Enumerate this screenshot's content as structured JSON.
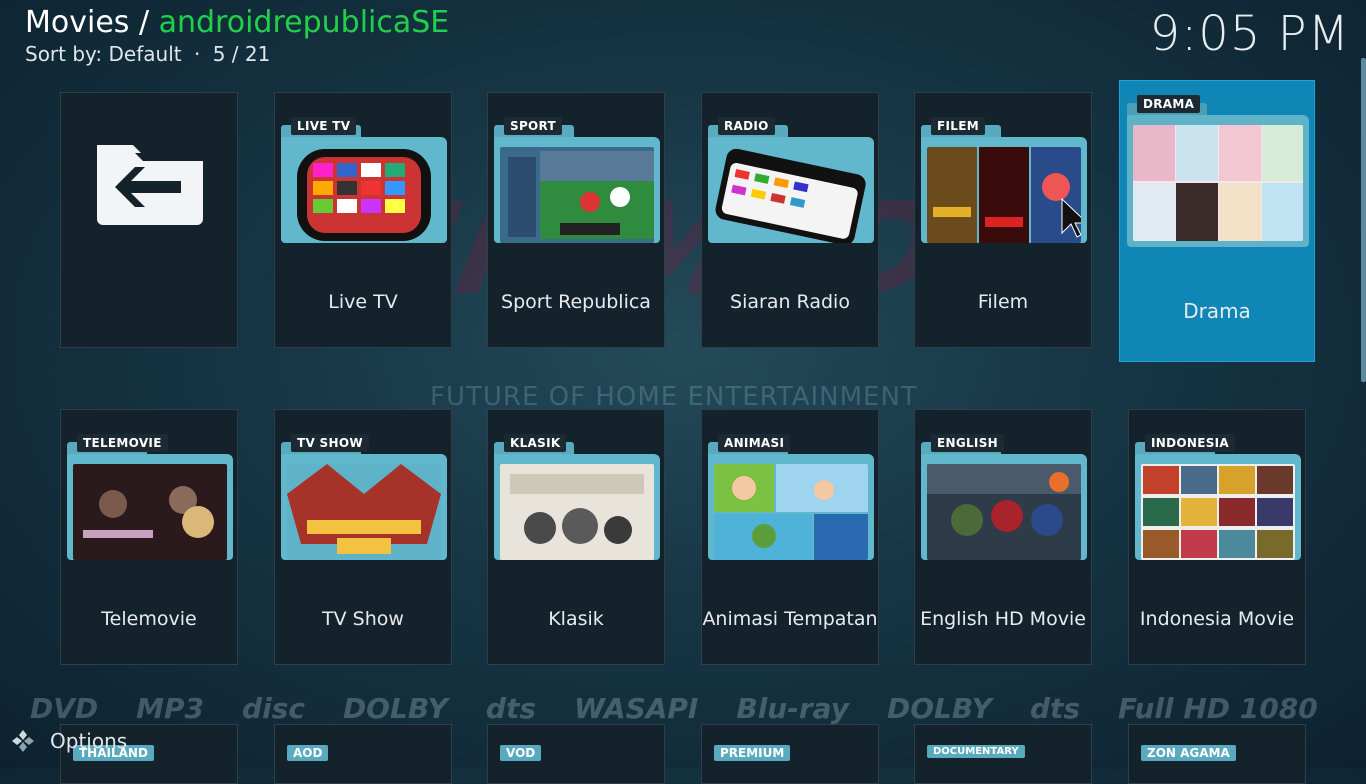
{
  "header": {
    "section": "Movies",
    "separator": " / ",
    "source": "androidrepublicaSE",
    "sort_label": "Sort by: Default",
    "dot": "·",
    "position": "5 / 21",
    "clock": "9:05 PM"
  },
  "background": {
    "wordmark": "KIR MEDIA CENTER",
    "tagline": "FUTURE OF HOME ENTERTAINMENT",
    "logos": [
      "DVD",
      "MP3",
      "disc",
      "DOLBY",
      "dts",
      "WASAPI",
      "Blu-ray",
      "DOLBY",
      "dts",
      "Full HD 1080"
    ]
  },
  "tiles": [
    {
      "label": "",
      "tag": "",
      "icon": "back-folder-icon"
    },
    {
      "label": "Live TV",
      "tag": "LIVE TV",
      "art": "tv-channels-art"
    },
    {
      "label": "Sport Republica",
      "tag": "SPORT",
      "art": "football-art"
    },
    {
      "label": "Siaran Radio",
      "tag": "RADIO",
      "art": "radio-art"
    },
    {
      "label": "Filem",
      "tag": "FILEM",
      "art": "movie-posters-art"
    },
    {
      "label": "Drama",
      "tag": "DRAMA",
      "art": "drama-posters-art"
    },
    {
      "label": "Telemovie",
      "tag": "TELEMOVIE",
      "art": "telemovie-art"
    },
    {
      "label": "TV Show",
      "tag": "TV SHOW",
      "art": "tvshow-art"
    },
    {
      "label": "Klasik",
      "tag": "KLASIK",
      "art": "klasik-art"
    },
    {
      "label": "Animasi Tempatan",
      "tag": "ANIMASI",
      "art": "animasi-art"
    },
    {
      "label": "English HD Movie",
      "tag": "ENGLISH",
      "art": "english-art"
    },
    {
      "label": "Indonesia Movie",
      "tag": "INDONESIA",
      "art": "indonesia-art"
    }
  ],
  "partial_tiles": [
    "THAILAND",
    "AOD",
    "VOD",
    "PREMIUM",
    "DOCUMENTARY",
    "ZON AGAMA"
  ],
  "footer": {
    "options_label": "Options"
  },
  "colors": {
    "accent": "#0f86b6",
    "source": "#21d04a",
    "folder": "#61b7cc"
  }
}
